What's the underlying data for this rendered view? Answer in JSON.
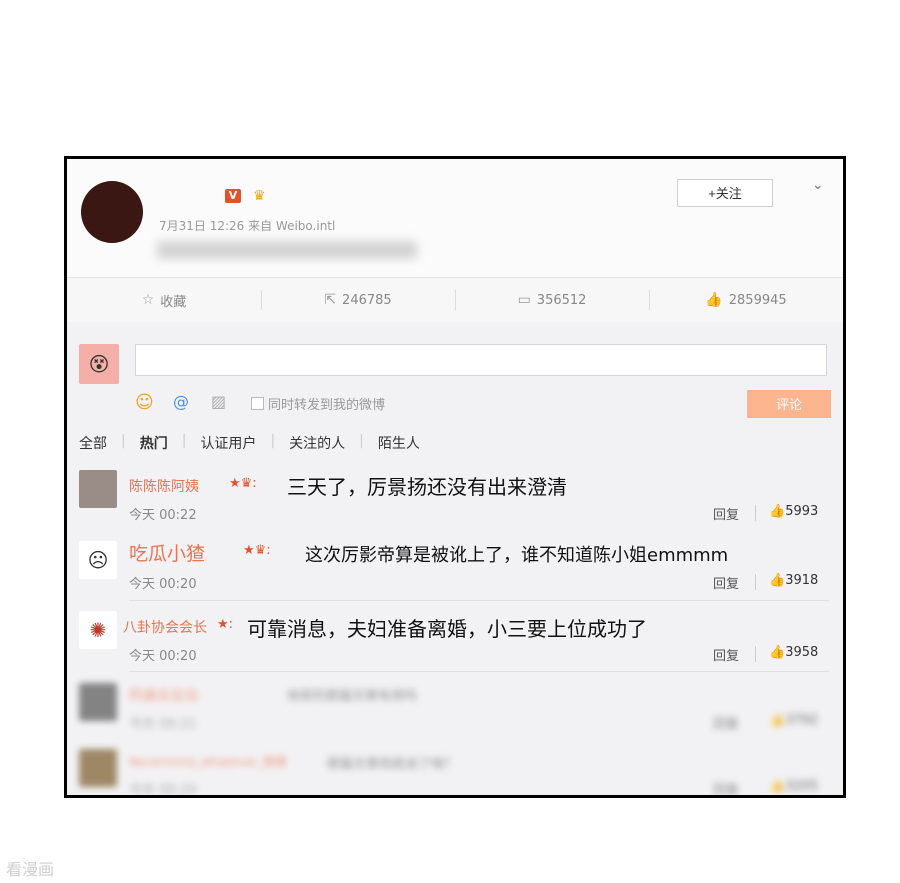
{
  "post": {
    "vip_badge": "V",
    "timestamp": "7月31日 12:26 来自 Weibo.intl",
    "follow_label": "+关注",
    "actions": [
      {
        "icon": "star-icon",
        "label": "收藏"
      },
      {
        "icon": "repost-icon",
        "label": "246785"
      },
      {
        "icon": "comment-icon",
        "label": "356512"
      },
      {
        "icon": "like-icon",
        "label": "2859945"
      }
    ]
  },
  "composer": {
    "repost_label": "同时转发到我的微博",
    "submit_label": "评论"
  },
  "filters": [
    "全部",
    "热门",
    "认证用户",
    "关注的人",
    "陌生人"
  ],
  "comments": [
    {
      "name": "陈陈陈阿姨",
      "text": "三天了，厉景扬还没有出来澄清",
      "time": "今天 00:22",
      "reply": "回复",
      "likes": "5993"
    },
    {
      "name": "吃瓜小猹",
      "text": "这次厉影帝算是被讹上了，谁不知道陈小姐emmmm",
      "time": "今天 00:20",
      "reply": "回复",
      "likes": "3918"
    },
    {
      "name": "八卦协会会长",
      "text": "可靠消息，夫妇准备离婚，小三要上位成功了",
      "time": "今天 00:20",
      "reply": "回复",
      "likes": "3958"
    },
    {
      "name": "同桌云云云",
      "text": "他家的那篇文章有用吗",
      "time": "今天 00:21",
      "reply": "回复",
      "likes": "3792"
    },
    {
      "name": "Nevermind_whatever_随便",
      "text": "那篇文章到底说了啥？",
      "time": "今天 00:20",
      "reply": "回复",
      "likes": "3205"
    }
  ],
  "watermark": "看漫画"
}
